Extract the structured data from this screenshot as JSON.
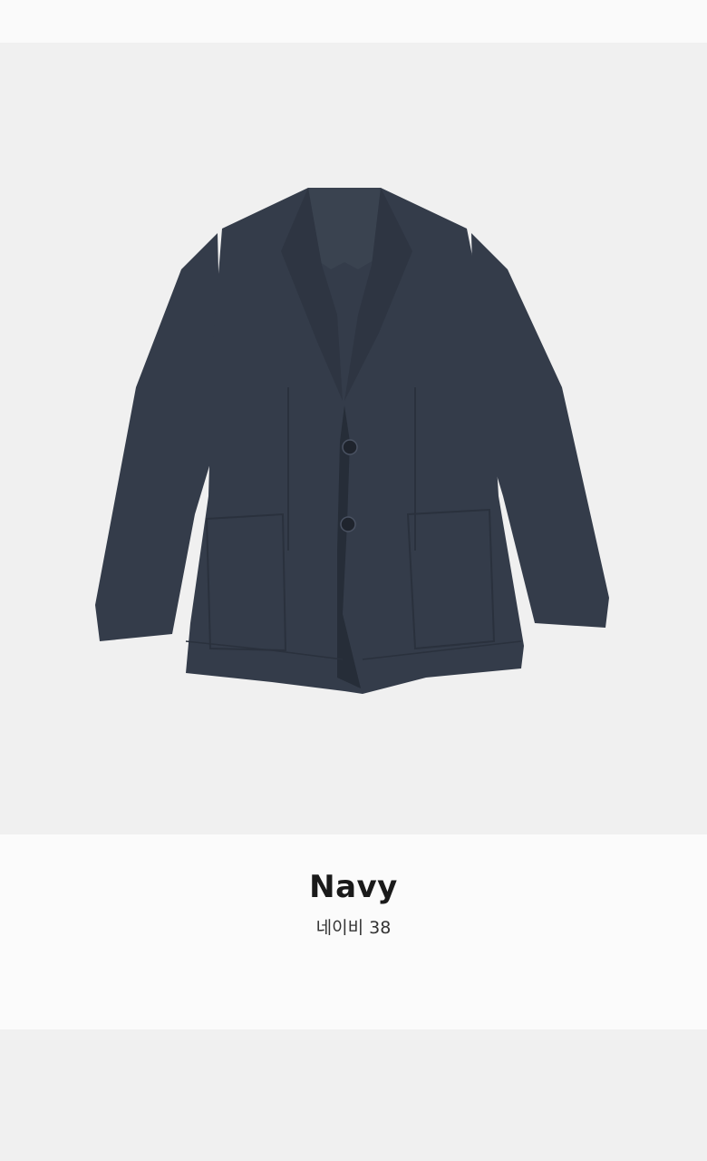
{
  "product": {
    "color_name": "Navy",
    "color_subtitle": "네이비 38",
    "image_subject": "navy-single-breasted-blazer",
    "colors": {
      "jacket": "#343c4a",
      "jacket_shadow": "#262d38",
      "lining": "#3a4350",
      "background": "#f0f0f0"
    }
  }
}
